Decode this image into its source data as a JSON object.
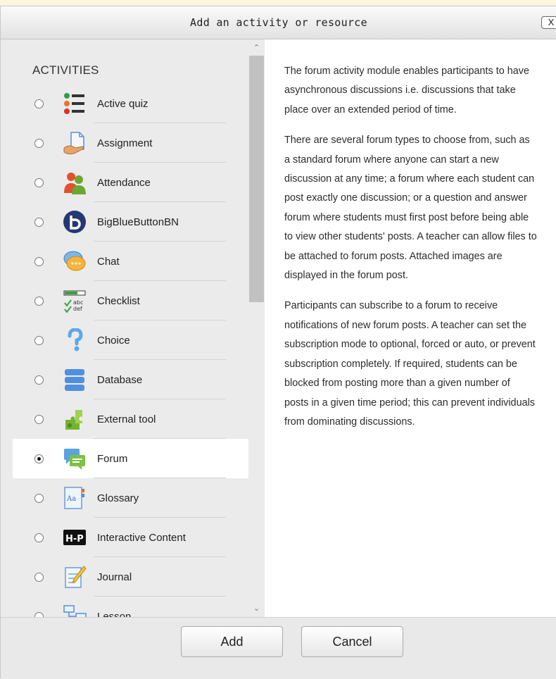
{
  "dialog": {
    "title": "Add an activity or resource",
    "close_label": "X"
  },
  "section_heading": "ACTIVITIES",
  "activities": [
    {
      "label": "Active quiz",
      "icon": "active-quiz-icon",
      "selected": false
    },
    {
      "label": "Assignment",
      "icon": "assignment-icon",
      "selected": false
    },
    {
      "label": "Attendance",
      "icon": "attendance-icon",
      "selected": false
    },
    {
      "label": "BigBlueButtonBN",
      "icon": "bigbluebutton-icon",
      "selected": false
    },
    {
      "label": "Chat",
      "icon": "chat-icon",
      "selected": false
    },
    {
      "label": "Checklist",
      "icon": "checklist-icon",
      "selected": false
    },
    {
      "label": "Choice",
      "icon": "choice-icon",
      "selected": false
    },
    {
      "label": "Database",
      "icon": "database-icon",
      "selected": false
    },
    {
      "label": "External tool",
      "icon": "external-tool-icon",
      "selected": false
    },
    {
      "label": "Forum",
      "icon": "forum-icon",
      "selected": true
    },
    {
      "label": "Glossary",
      "icon": "glossary-icon",
      "selected": false
    },
    {
      "label": "Interactive Content",
      "icon": "h5p-icon",
      "selected": false
    },
    {
      "label": "Journal",
      "icon": "journal-icon",
      "selected": false
    },
    {
      "label": "Lesson",
      "icon": "lesson-icon",
      "selected": false
    }
  ],
  "description": [
    "The forum activity module enables participants to have asynchronous discussions i.e. discussions that take place over an extended period of time.",
    "There are several forum types to choose from, such as a standard forum where anyone can start a new discussion at any time; a forum where each student can post exactly one discussion; or a question and answer forum where students must first post before being able to view other students' posts. A teacher can allow files to be attached to forum posts. Attached images are displayed in the forum post.",
    "Participants can subscribe to a forum to receive notifications of new forum posts. A teacher can set the subscription mode to optional, forced or auto, or prevent subscription completely. If required, students can be blocked from posting more than a given number of posts in a given time period; this can prevent individuals from dominating discussions."
  ],
  "footer": {
    "add_label": "Add",
    "cancel_label": "Cancel"
  },
  "colors": {
    "background": "#fbf6dc",
    "pane_gray": "#ebebeb",
    "selected_row": "#ffffff"
  }
}
